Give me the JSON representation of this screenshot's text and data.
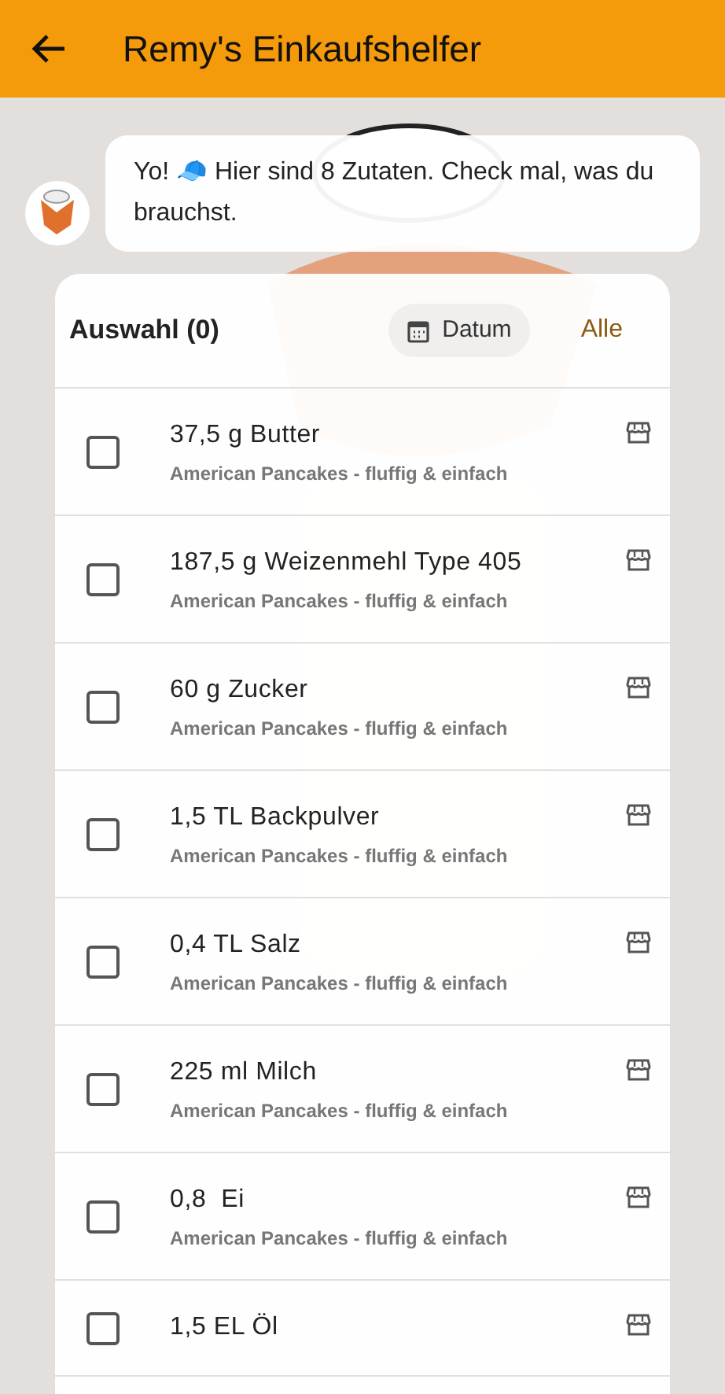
{
  "app_bar": {
    "title": "Remy's Einkaufshelfer"
  },
  "message": {
    "text": "Yo! 🧢 Hier sind 8 Zutaten. Check mal, was du brauchst."
  },
  "list_header": {
    "title": "Auswahl (0)",
    "date_button": "Datum",
    "all_button": "Alle"
  },
  "items": [
    {
      "name": "37,5 g Butter",
      "recipe": "American Pancakes - fluffig & einfach",
      "checked": false
    },
    {
      "name": "187,5 g Weizenmehl Type 405",
      "recipe": "American Pancakes - fluffig & einfach",
      "checked": false
    },
    {
      "name": "60 g Zucker",
      "recipe": "American Pancakes - fluffig & einfach",
      "checked": false
    },
    {
      "name": "1,5 TL Backpulver",
      "recipe": "American Pancakes - fluffig & einfach",
      "checked": false
    },
    {
      "name": "0,4 TL Salz",
      "recipe": "American Pancakes - fluffig & einfach",
      "checked": false
    },
    {
      "name": "225 ml Milch",
      "recipe": "American Pancakes - fluffig & einfach",
      "checked": false
    },
    {
      "name": "0,8  Ei",
      "recipe": "American Pancakes - fluffig & einfach",
      "checked": false
    },
    {
      "name": "1,5 EL Öl",
      "checked": false
    }
  ]
}
